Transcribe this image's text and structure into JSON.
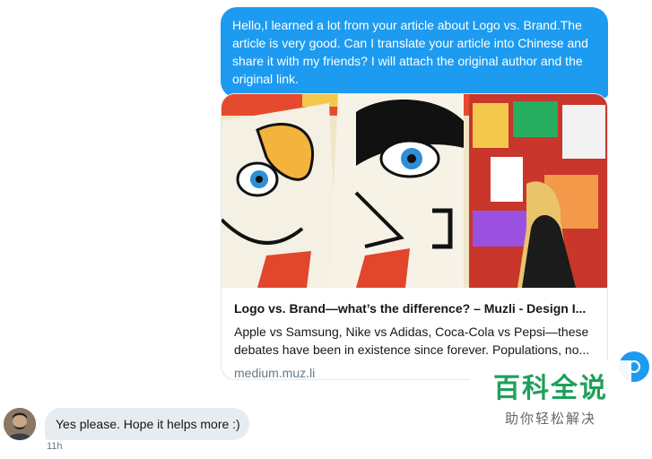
{
  "messages": {
    "outgoing_text": "Hello,I learned a lot from your article about Logo vs. Brand.The article is very good. Can I translate your article into Chinese and share it with my friends? I will attach the original author and the original link.",
    "link_card": {
      "image_alt": "Colorful street art mural of two stylized faces",
      "title": "Logo vs. Brand—what’s the difference? – Muzli - Design I...",
      "description": "Apple vs Samsung, Nike vs Adidas, Coca-Cola vs Pepsi—these debates have been in existence since forever. Populations, no...",
      "domain": "medium.muz.li"
    },
    "incoming_text": "Yes please. Hope it helps more :)",
    "incoming_timestamp": "11h"
  },
  "watermark": {
    "main": "百科全说",
    "sub": "助你轻松解决"
  },
  "colors": {
    "accent": "#1d9bf0",
    "incoming_bubble": "#e6ecf0",
    "watermark_green": "#1fa15a"
  },
  "icons": {
    "avatar": "user-avatar",
    "scroll": "scroll-down-icon"
  }
}
